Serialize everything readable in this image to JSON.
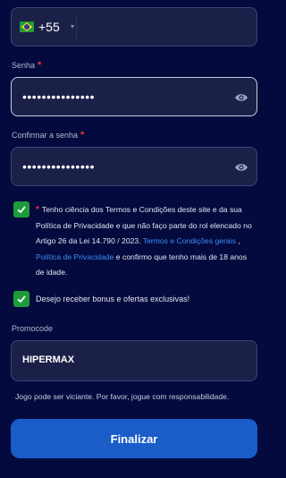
{
  "phone": {
    "country_code": "+55",
    "flag_icon": "brazil-flag-icon",
    "value": ""
  },
  "password": {
    "label": "Senha",
    "required_mark": "*",
    "value": "•••••••••••••••",
    "icon": "eye-icon"
  },
  "confirm_password": {
    "label": "Confirmar a senha",
    "required_mark": "*",
    "value": "•••••••••••••••",
    "icon": "eye-icon"
  },
  "terms": {
    "checked": true,
    "required_mark": "*",
    "text_1": "Tenho ciência dos Termos e Condições deste site e da sua Política de Privacidade e que não faço parte do rol elencado no Artigo 26 da Lei 14.790 / 2023. ",
    "link_1": "Termos e Condições gerais",
    "text_2": " , ",
    "link_2": "Política de Privacidade",
    "text_3": " e confirmo que tenho mais de 18 anos de idade."
  },
  "bonus": {
    "checked": true,
    "label": "Desejo receber bonus e ofertas exclusivas!"
  },
  "promocode": {
    "label": "Promocode",
    "value": "HIPERMAX"
  },
  "warning": "Jogo pode ser viciante. Por favor, jogue com responsabilidade.",
  "submit_label": "Finalizar",
  "colors": {
    "background": "#040a3e",
    "input": "#1b2048",
    "accent": "#1a5cc8",
    "check": "#1c9c3a",
    "required": "#e8323c",
    "link": "#3d8df5"
  }
}
